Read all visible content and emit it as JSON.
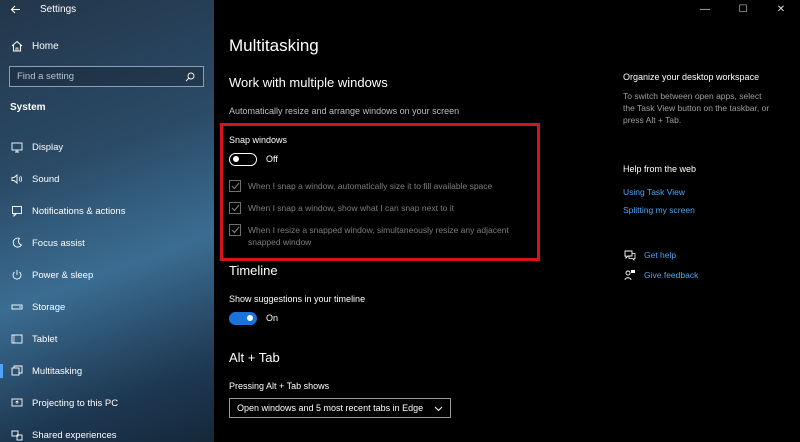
{
  "window": {
    "app_title": "Settings",
    "controls": {
      "minimize": "—",
      "maximize": "☐",
      "close": "✕"
    }
  },
  "sidebar": {
    "home_label": "Home",
    "search_placeholder": "Find a setting",
    "section_title": "System",
    "items": [
      {
        "label": "Display",
        "icon": "display-icon"
      },
      {
        "label": "Sound",
        "icon": "sound-icon"
      },
      {
        "label": "Notifications & actions",
        "icon": "notifications-icon"
      },
      {
        "label": "Focus assist",
        "icon": "focus-assist-icon"
      },
      {
        "label": "Power & sleep",
        "icon": "power-icon"
      },
      {
        "label": "Storage",
        "icon": "storage-icon"
      },
      {
        "label": "Tablet",
        "icon": "tablet-icon"
      },
      {
        "label": "Multitasking",
        "icon": "multitasking-icon",
        "active": true
      },
      {
        "label": "Projecting to this PC",
        "icon": "projecting-icon"
      },
      {
        "label": "Shared experiences",
        "icon": "shared-experiences-icon"
      }
    ]
  },
  "main": {
    "page_title": "Multitasking",
    "windows_section": {
      "heading": "Work with multiple windows",
      "description": "Automatically resize and arrange windows on your screen",
      "snap_label": "Snap windows",
      "snap_state": "Off",
      "options": [
        "When I snap a window, automatically size it to fill available space",
        "When I snap a window, show what I can snap next to it",
        "When I resize a snapped window, simultaneously resize any adjacent snapped window"
      ]
    },
    "timeline_section": {
      "heading": "Timeline",
      "suggestions_label": "Show suggestions in your timeline",
      "suggestions_state": "On"
    },
    "alttab_section": {
      "heading": "Alt + Tab",
      "label": "Pressing Alt + Tab shows",
      "selected": "Open windows and 5 most recent tabs in Edge"
    }
  },
  "right_panel": {
    "organize_heading": "Organize your desktop workspace",
    "organize_text": "To switch between open apps, select the Task View button on the taskbar, or press Alt + Tab.",
    "help_heading": "Help from the web",
    "links": [
      "Using Task View",
      "Splitting my screen"
    ],
    "get_help": "Get help",
    "give_feedback": "Give feedback"
  },
  "colors": {
    "accent": "#1a73d9",
    "link": "#4ea3f5",
    "highlight": "#d4141c"
  }
}
